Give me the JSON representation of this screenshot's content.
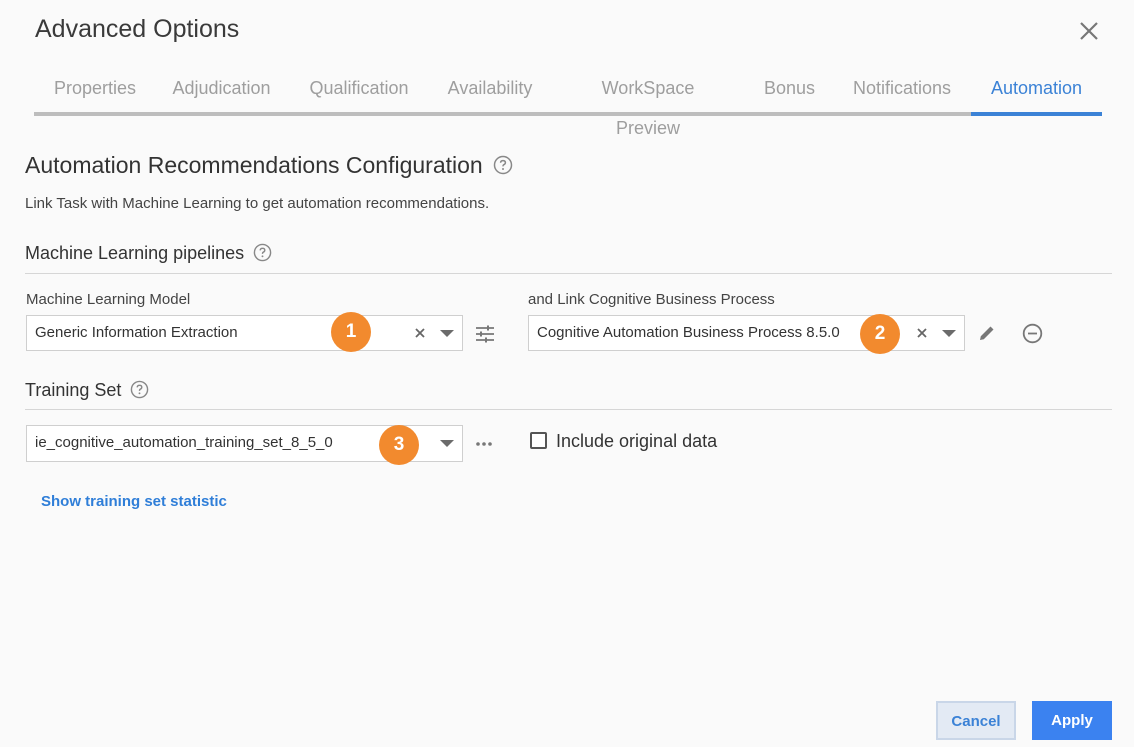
{
  "dialog": {
    "title": "Advanced Options"
  },
  "tabs": [
    {
      "label": "Properties"
    },
    {
      "label": "Adjudication"
    },
    {
      "label": "Qualification"
    },
    {
      "label": "Availability"
    },
    {
      "label": "WorkSpace Preview"
    },
    {
      "label": "Bonus"
    },
    {
      "label": "Notifications"
    },
    {
      "label": "Automation",
      "active": true
    }
  ],
  "section": {
    "title": "Automation Recommendations Configuration",
    "subtitle": "Link Task with Machine Learning to get automation recommendations."
  },
  "pipelines": {
    "title": "Machine Learning pipelines",
    "model_label": "Machine Learning Model",
    "model_value": "Generic Information Extraction",
    "process_label": "and Link Cognitive Business Process",
    "process_value": "Cognitive Automation Business Process 8.5.0"
  },
  "training": {
    "title": "Training Set",
    "value": "ie_cognitive_automation_training_set_8_5_0",
    "include_label": "Include original data",
    "include_checked": false,
    "statistic_link": "Show training set statistic"
  },
  "badges": [
    "1",
    "2",
    "3"
  ],
  "footer": {
    "cancel_label": "Cancel",
    "apply_label": "Apply"
  },
  "colors": {
    "accent": "#3b82d6",
    "badge": "#f28a2e",
    "apply": "#3b82f0"
  },
  "icons": [
    "close-icon",
    "help-icon",
    "clear-icon",
    "caret-down-icon",
    "sliders-icon",
    "more-horizontal-icon",
    "pencil-icon",
    "remove-circle-icon"
  ]
}
